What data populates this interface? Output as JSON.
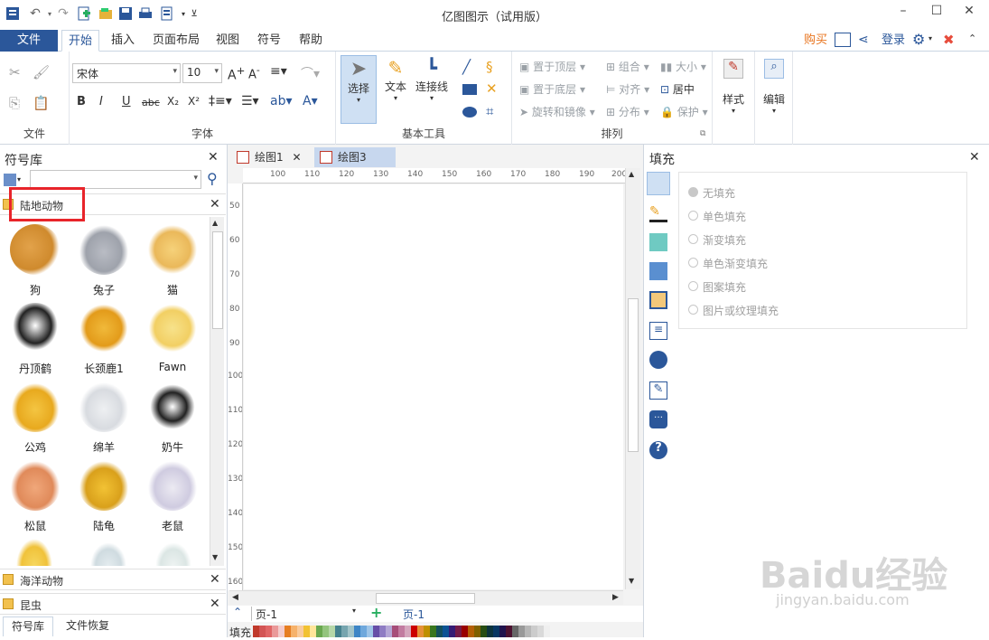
{
  "app": {
    "title": "亿图图示（试用版）",
    "buy": "购买",
    "login": "登录"
  },
  "menu": {
    "file": "文件",
    "tabs": [
      "开始",
      "插入",
      "页面布局",
      "视图",
      "符号",
      "帮助"
    ]
  },
  "ribbon": {
    "file_group": "文件",
    "font_group": "字体",
    "font_name": "宋体",
    "font_size": "10",
    "tools_group": "基本工具",
    "select": "选择",
    "text": "文本",
    "connector": "连接线",
    "arrange_group": "排列",
    "bring_front": "置于顶层",
    "send_back": "置于底层",
    "rotate_mirror": "旋转和镜像",
    "group": "组合",
    "align": "对齐",
    "distribute": "分布",
    "size": "大小",
    "center": "居中",
    "protect": "保护",
    "style": "样式",
    "edit": "编辑"
  },
  "library": {
    "title": "符号库",
    "category_active": "陆地动物",
    "animals": [
      "狗",
      "兔子",
      "猫",
      "丹顶鹤",
      "长颈鹿1",
      "Fawn",
      "公鸡",
      "绵羊",
      "奶牛",
      "松鼠",
      "陆龟",
      "老鼠"
    ],
    "category_2": "海洋动物",
    "category_3": "昆虫",
    "bottom_tabs": [
      "符号库",
      "文件恢复"
    ]
  },
  "documents": {
    "tabs": [
      "绘图1",
      "绘图3"
    ],
    "hruler": [
      "100",
      "110",
      "120",
      "130",
      "140",
      "150",
      "160",
      "170",
      "180",
      "190",
      "200"
    ],
    "vruler": [
      "50",
      "60",
      "70",
      "80",
      "90",
      "100",
      "110",
      "120",
      "130",
      "140",
      "150",
      "160"
    ],
    "page_select": "页-1",
    "page_tab": "页-1",
    "fill_label": "填充"
  },
  "fill_panel": {
    "title": "填充",
    "options": [
      "无填充",
      "单色填充",
      "渐变填充",
      "单色渐变填充",
      "图案填充",
      "图片或纹理填充"
    ]
  },
  "watermark": {
    "brand": "Baidu经验",
    "url": "jingyan.baidu.com"
  },
  "colors": {
    "accent": "#2b579a",
    "highlight_box": "#e8242a",
    "palette": [
      "#c0392b",
      "#d35454",
      "#e06666",
      "#ea9999",
      "#f4cccc",
      "#e67e22",
      "#f6b26b",
      "#f9cb9c",
      "#f1c232",
      "#ffe599",
      "#6aa84f",
      "#93c47d",
      "#b6d7a8",
      "#45818e",
      "#76a5af",
      "#a2c4c9",
      "#3d85c6",
      "#6fa8dc",
      "#9fc5e8",
      "#674ea7",
      "#8e7cc3",
      "#b4a7d6",
      "#a64d79",
      "#c27ba0",
      "#d5a6bd",
      "#cc0000",
      "#e69138",
      "#bf9000",
      "#38761d",
      "#134f5c",
      "#0b5394",
      "#351c75",
      "#741b47",
      "#990000",
      "#b45f06",
      "#7f6000",
      "#274e13",
      "#0c343d",
      "#073763",
      "#20124d",
      "#4c1130",
      "#666666",
      "#999999",
      "#b7b7b7",
      "#cccccc",
      "#d9d9d9",
      "#efefef",
      "#f3f3f3"
    ]
  }
}
